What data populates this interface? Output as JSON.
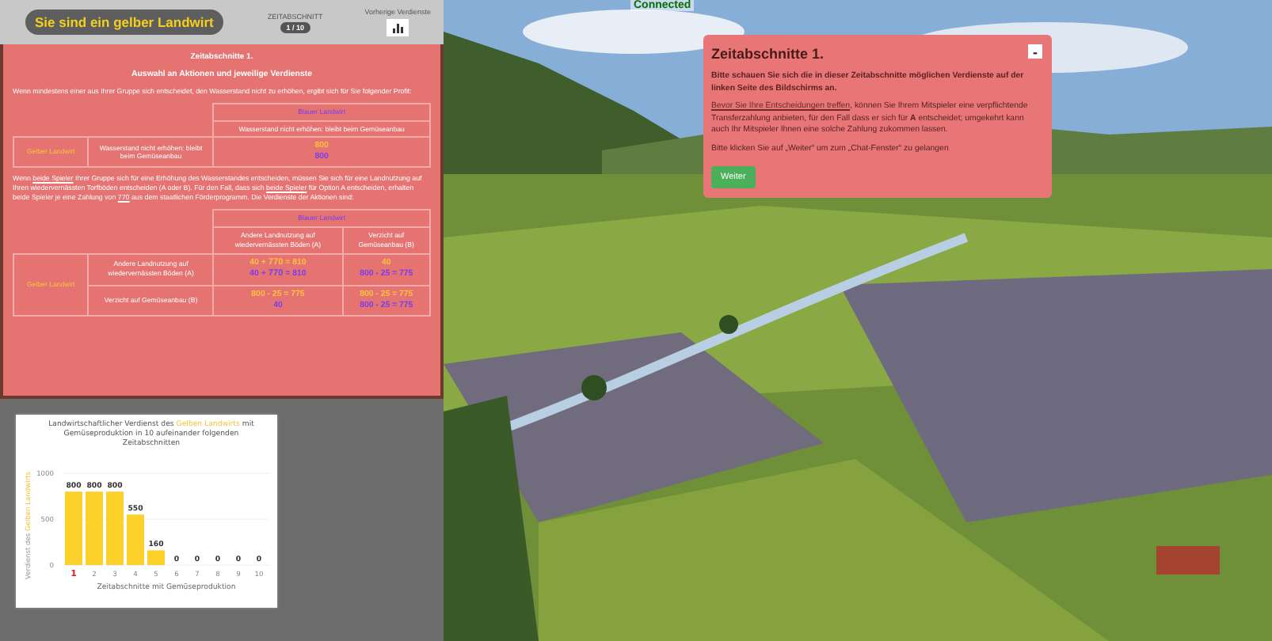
{
  "header": {
    "role_label": "Sie sind ein gelber Landwirt",
    "period_caption": "ZEITABSCHNITT",
    "period_badge": "1 / 10",
    "history_caption": "Vorherige Verdienste"
  },
  "rules": {
    "title": "Zeitabschnitte 1.",
    "subtitle": "Auswahl an Aktionen und jeweilige Verdienste",
    "intro": "Wenn mindestens einer aus Ihrer Gruppe sich entscheidet, den Wasserstand nicht zu erhöhen, ergibt sich für Sie folgender Profit:",
    "table_1": {
      "column_header": "Blauer Landwirt",
      "columns": [
        "Wasserstand nicht erhöhen: bleibt beim Gemüseanbau"
      ],
      "row_header": "Gelber Landwirt",
      "rows": [
        {
          "label": "Wasserstand nicht erhöhen: bleibt beim Gemüseanbau",
          "cells": [
            [
              {
                "color": "#f7c23c",
                "text": "800"
              },
              {
                "color": "#7a3df0",
                "text": "800"
              }
            ]
          ]
        }
      ]
    },
    "paragraph": "Wenn **beide Spieler** Ihrer Gruppe sich für eine Erhöhung des Wasserstandes entscheiden, müssen Sie sich für eine Landnutzung auf Ihren wiedervernässten Torfböden entscheiden (A oder B). Für den Fall, dass sich **beide Spieler** für Option A entscheiden, erhalten beide Spieler je eine Zahlung von **770** aus dem staatlichen Förderprogramm. Die Verdienste der Aktionen sind:",
    "table_2": {
      "column_header": "Blauer Landwirt",
      "columns": [
        "Andere Landnutzung auf wiedervernässten Böden (A)",
        "Verzicht auf Gemüseanbau (B)"
      ],
      "row_header": "Gelber Landwirt",
      "rows": [
        {
          "label": "Andere Landnutzung auf wiedervernässten Böden (A)",
          "cells": [
            [
              {
                "color": "#f7c23c",
                "text": "40 + **770** = 810"
              },
              {
                "color": "#7a3df0",
                "text": "40 + **770** = 810"
              }
            ],
            [
              {
                "color": "#f7c23c",
                "text": "40"
              },
              {
                "color": "#7a3df0",
                "text": "800 - 25 = 775"
              }
            ]
          ]
        },
        {
          "label": "Verzicht auf Gemüseanbau (B)",
          "cells": [
            [
              {
                "color": "#f7c23c",
                "text": "800 - 25 = 775"
              },
              {
                "color": "#7a3df0",
                "text": "40"
              }
            ],
            [
              {
                "color": "#f7c23c",
                "text": "800 - 25 = 775"
              },
              {
                "color": "#7a3df0",
                "text": "800 - 25 = 775"
              }
            ]
          ]
        }
      ]
    }
  },
  "chart": {
    "current_period": "1",
    "chart_data": {
      "type": "bar",
      "title": "Landwirtschaftlicher Verdienst des **Gelben Landwirts** mit Gemüseproduktion in 10 aufeinander folgenden Zeitabschnitten",
      "xlabel": "Zeitabschnitte mit Gemüseproduktion",
      "ylabel": "Verdienst des **Gelben Landwirts**",
      "categories": [
        "1",
        "2",
        "3",
        "4",
        "5",
        "6",
        "7",
        "8",
        "9",
        "10"
      ],
      "series": [
        {
          "color": "#fcd12a",
          "values": [
            800,
            800,
            800,
            550,
            160,
            0,
            0,
            0,
            0,
            0
          ]
        }
      ],
      "ylim": [
        0,
        1000
      ],
      "yticks": [
        0,
        500,
        1000
      ],
      "data_labels": true
    }
  },
  "scene": {
    "status": "Connected"
  },
  "dialog": {
    "title": "Zeitabschnitte 1.",
    "close_label": "-",
    "lead": "Bitte schauen Sie sich die in dieser Zeitabschnitte möglichen Verdienste auf der linken Seite des Bildschirms an.",
    "link": "Bevor Sie Ihre Entscheidungen treffen",
    "body": ", können Sie Ihrem Mitspieler eine verpflichtende Transferzahlung anbieten, für den Fall dass er sich für **A** entscheidet; umgekehrt kann auch Ihr Mitspieler Ihnen eine solche Zahlung zukommen lassen.",
    "note": "Bitte klicken Sie auf „Weiter“ um zum „Chat-Fenster“ zu gelangen",
    "button": "Weiter"
  }
}
